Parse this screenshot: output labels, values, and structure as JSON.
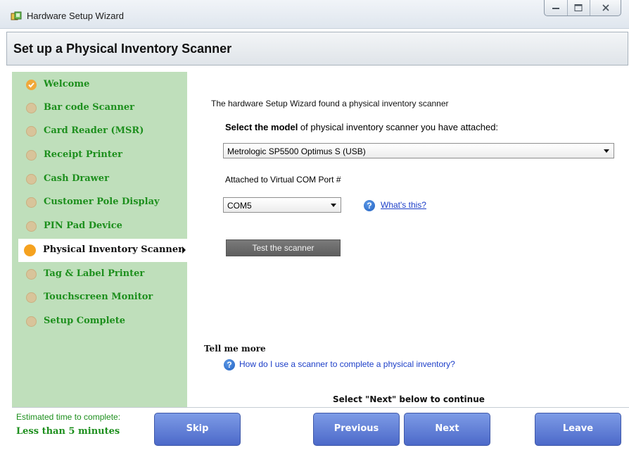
{
  "window": {
    "title": "Hardware Setup Wizard",
    "controls": [
      "minimize-icon",
      "maximize-icon",
      "close-icon"
    ]
  },
  "header": {
    "title": "Set up a Physical Inventory Scanner"
  },
  "sidebar": {
    "steps": [
      {
        "label": "Welcome",
        "state": "done"
      },
      {
        "label": "Bar code Scanner",
        "state": "pending"
      },
      {
        "label": "Card Reader (MSR)",
        "state": "pending"
      },
      {
        "label": "Receipt Printer",
        "state": "pending"
      },
      {
        "label": "Cash Drawer",
        "state": "pending"
      },
      {
        "label": "Customer Pole Display",
        "state": "pending"
      },
      {
        "label": "PIN Pad Device",
        "state": "pending"
      },
      {
        "label": "Physical Inventory Scanner",
        "state": "current"
      },
      {
        "label": "Tag & Label Printer",
        "state": "pending"
      },
      {
        "label": "Touchscreen Monitor",
        "state": "pending"
      },
      {
        "label": "Setup Complete",
        "state": "pending"
      }
    ]
  },
  "main": {
    "intro": "The hardware Setup Wizard found a physical inventory scanner",
    "model_prompt_bold": "Select the model",
    "model_prompt_rest": " of physical inventory scanner you have attached:",
    "model_value": "Metrologic SP5500 Optimus S (USB)",
    "com_label": "Attached to Virtual COM Port #",
    "com_value": "COM5",
    "whats_this": "What's this?",
    "test_button": "Test the scanner",
    "tell_more": "Tell me more",
    "help_link": "How do I use a scanner to complete a physical inventory?",
    "continue_hint": "Select \"Next\" below to continue"
  },
  "footer": {
    "estimate_label": "Estimated time to complete:",
    "estimate_value": "Less than 5 minutes",
    "skip": "Skip",
    "previous": "Previous",
    "next": "Next",
    "leave": "Leave"
  },
  "colors": {
    "sidebar_bg": "#bfdfbb",
    "step_text": "#1d8f1d",
    "button_blue": "#5a77d4",
    "link_blue": "#1d3fc8",
    "current_dot": "#f5a21f"
  }
}
